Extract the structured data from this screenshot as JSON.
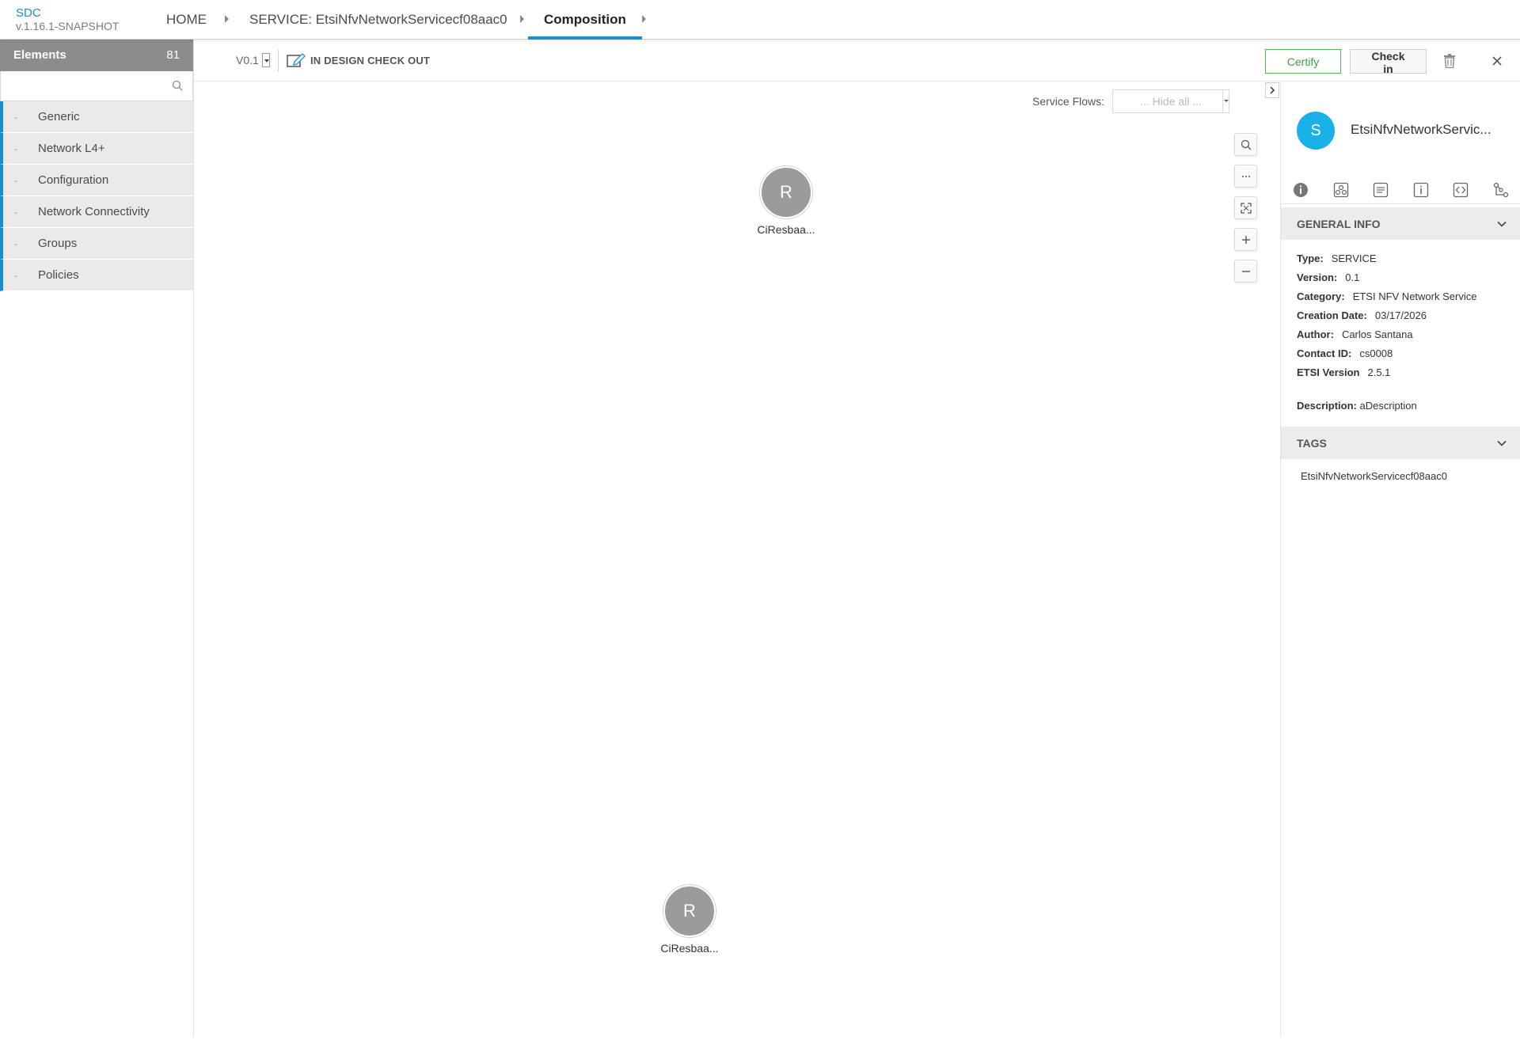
{
  "app": {
    "name": "SDC",
    "version": "v.1.16.1-SNAPSHOT"
  },
  "breadcrumbs": [
    {
      "label": "HOME"
    },
    {
      "label": "SERVICE: EtsiNfvNetworkServicecf08aac0"
    },
    {
      "label": "Composition"
    }
  ],
  "left_panel": {
    "title": "Elements",
    "count": "81",
    "search": {
      "value": "",
      "placeholder": ""
    },
    "categories": [
      {
        "label": "Generic",
        "marker": "-"
      },
      {
        "label": "Network L4+",
        "marker": "-"
      },
      {
        "label": "Configuration",
        "marker": "-"
      },
      {
        "label": "Network Connectivity",
        "marker": "-"
      },
      {
        "label": "Groups",
        "marker": "-"
      },
      {
        "label": "Policies",
        "marker": "-"
      }
    ]
  },
  "toolbar": {
    "version": "V0.1",
    "status": "IN DESIGN CHECK OUT",
    "certify_label": "Certify",
    "checkin_label": "Check in"
  },
  "canvas": {
    "service_flows_label": "Service Flows:",
    "service_flows_value": "... Hide all ...",
    "nodes": [
      {
        "letter": "R",
        "label": "CiResbaa..."
      },
      {
        "letter": "R",
        "label": "CiResbaa..."
      }
    ]
  },
  "right_panel": {
    "avatar_letter": "S",
    "service_name": "EtsiNfvNetworkServic...",
    "general_info_title": "GENERAL INFO",
    "info": [
      {
        "key": "Type:",
        "value": "SERVICE"
      },
      {
        "key": "Version:",
        "value": "0.1"
      },
      {
        "key": "Category:",
        "value": "ETSI NFV Network Service"
      },
      {
        "key": "Creation Date:",
        "value": "03/17/2026"
      },
      {
        "key": "Author:",
        "value": "Carlos Santana"
      },
      {
        "key": "Contact ID:",
        "value": "cs0008"
      },
      {
        "key": "ETSI Version",
        "value": "2.5.1"
      }
    ],
    "description_key": "Description:",
    "description_value": "aDescription",
    "tags_title": "TAGS",
    "tags": [
      "EtsiNfvNetworkServicecf08aac0"
    ]
  },
  "colors": {
    "accent": "#1a8fd0",
    "certify": "#3fa33f",
    "avatar": "#1ab0e8",
    "node": "#9b9b9b"
  }
}
